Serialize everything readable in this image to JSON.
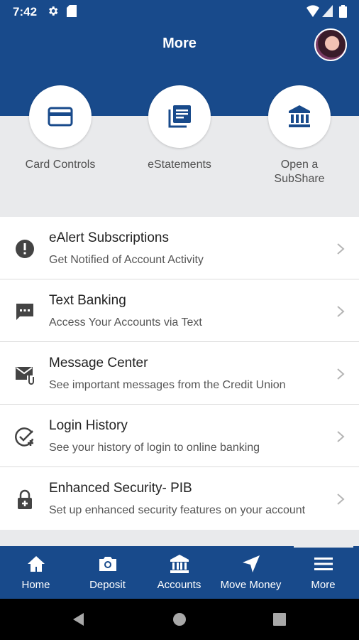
{
  "status_bar": {
    "time": "7:42"
  },
  "header": {
    "title": "More"
  },
  "quick_actions": [
    {
      "label": "Card Controls",
      "icon": "credit-card-icon"
    },
    {
      "label": "eStatements",
      "icon": "statements-icon"
    },
    {
      "label": "Open a\nSubShare",
      "icon": "bank-icon"
    }
  ],
  "menu_items": [
    {
      "title": "eAlert Subscriptions",
      "subtitle": "Get Notified of Account Activity",
      "icon": "alert-icon"
    },
    {
      "title": "Text Banking",
      "subtitle": "Access Your Accounts via Text",
      "icon": "chat-icon"
    },
    {
      "title": "Message Center",
      "subtitle": "See important messages from the Credit Union",
      "icon": "mail-icon"
    },
    {
      "title": "Login History",
      "subtitle": "See your history of login to online banking",
      "icon": "check-history-icon"
    },
    {
      "title": "Enhanced Security- PIB",
      "subtitle": "Set up enhanced security features on your account",
      "icon": "lock-icon"
    }
  ],
  "bottom_nav": [
    {
      "label": "Home",
      "icon": "home-icon"
    },
    {
      "label": "Deposit",
      "icon": "camera-icon"
    },
    {
      "label": "Accounts",
      "icon": "bank-icon"
    },
    {
      "label": "Move Money",
      "icon": "navigation-arrow-icon"
    },
    {
      "label": "More",
      "icon": "menu-icon",
      "active": true
    }
  ],
  "colors": {
    "brand": "#184a8b",
    "background": "#e9eaec",
    "text": "#222222",
    "subtext": "#555555"
  }
}
